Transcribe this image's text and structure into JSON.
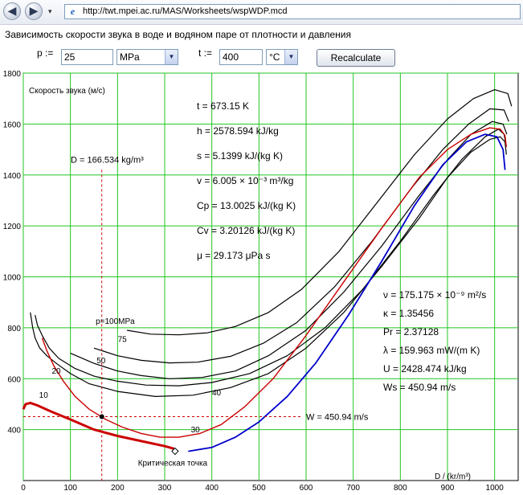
{
  "browser": {
    "url": "http://twt.mpei.ac.ru/MAS/Worksheets/wspWDP.mcd"
  },
  "page": {
    "title": "Зависимость скорости звука в воде и водяном паре  от плотности и давления",
    "pressure_label": "p :=",
    "pressure_value": "25",
    "pressure_unit": "MPa",
    "temperature_label": "t :=",
    "temperature_value": "400",
    "temperature_unit": "°C",
    "recalculate_label": "Recalculate"
  },
  "chart_data": {
    "type": "line",
    "title": "Скорость звука (м/с)",
    "xlabel": "D / (kr/m³)",
    "xlim": [
      0,
      1050
    ],
    "ylim": [
      200,
      1800
    ],
    "grid": true,
    "x_ticks": [
      0,
      100,
      200,
      300,
      400,
      500,
      600,
      700,
      800,
      900,
      1000
    ],
    "y_ticks": [
      400,
      600,
      800,
      1000,
      1200,
      1400,
      1600,
      1800
    ],
    "isobar_labels": [
      {
        "text": "p=100MPa",
        "x": 195,
        "y": 815
      },
      {
        "text": "75",
        "x": 210,
        "y": 745
      },
      {
        "text": "50",
        "x": 165,
        "y": 660
      },
      {
        "text": "40",
        "x": 410,
        "y": 535
      },
      {
        "text": "30",
        "x": 365,
        "y": 390
      },
      {
        "text": "20",
        "x": 70,
        "y": 620
      },
      {
        "text": "10",
        "x": 43,
        "y": 525
      }
    ],
    "series": [
      {
        "name": "",
        "color": "#000000",
        "width": 1.2,
        "x": [
          15,
          20,
          25,
          35,
          50,
          70,
          100,
          140,
          200,
          280,
          360,
          440,
          520,
          600,
          680,
          760,
          840,
          900,
          950,
          990,
          1012,
          1022,
          1025
        ],
        "y": [
          860,
          800,
          760,
          720,
          690,
          660,
          620,
          580,
          550,
          530,
          535,
          565,
          620,
          720,
          860,
          1040,
          1230,
          1390,
          1490,
          1540,
          1550,
          1530,
          1480
        ]
      },
      {
        "name": "",
        "color": "#000000",
        "width": 1.2,
        "x": [
          25,
          30,
          40,
          55,
          75,
          110,
          150,
          200,
          260,
          330,
          400,
          480,
          560,
          640,
          720,
          800,
          870,
          930,
          980,
          1008,
          1020,
          1024
        ],
        "y": [
          850,
          810,
          770,
          720,
          680,
          640,
          610,
          590,
          575,
          572,
          585,
          620,
          690,
          800,
          950,
          1140,
          1320,
          1460,
          1550,
          1580,
          1560,
          1520
        ]
      },
      {
        "name": "",
        "color": "#000000",
        "width": 1.2,
        "x": [
          100,
          150,
          200,
          250,
          310,
          380,
          450,
          520,
          600,
          680,
          760,
          840,
          900,
          950,
          995,
          1018,
          1026
        ],
        "y": [
          700,
          660,
          630,
          612,
          600,
          605,
          630,
          690,
          790,
          940,
          1120,
          1320,
          1460,
          1560,
          1610,
          1600,
          1560
        ]
      },
      {
        "name": "",
        "color": "#000000",
        "width": 1.2,
        "x": [
          150,
          200,
          250,
          310,
          370,
          440,
          510,
          580,
          660,
          740,
          820,
          890,
          945,
          990,
          1020,
          1030
        ],
        "y": [
          720,
          690,
          672,
          662,
          665,
          688,
          740,
          820,
          960,
          1140,
          1340,
          1500,
          1600,
          1660,
          1655,
          1610
        ]
      },
      {
        "name": "",
        "color": "#000000",
        "width": 1.2,
        "x": [
          220,
          270,
          330,
          390,
          450,
          520,
          590,
          670,
          750,
          830,
          900,
          955,
          1000,
          1028,
          1036
        ],
        "y": [
          790,
          775,
          772,
          780,
          805,
          860,
          950,
          1100,
          1290,
          1480,
          1620,
          1700,
          1735,
          1720,
          1670
        ]
      },
      {
        "name": "",
        "color": "#cc0000",
        "width": 1.4,
        "x": [
          40,
          50,
          65,
          85,
          110,
          140,
          175,
          210,
          250,
          290,
          330,
          375,
          420,
          470,
          530,
          600,
          680,
          760,
          840,
          900,
          950,
          990,
          1012,
          1022,
          1025
        ],
        "y": [
          760,
          710,
          650,
          590,
          530,
          480,
          440,
          410,
          385,
          370,
          370,
          385,
          420,
          490,
          600,
          770,
          980,
          1190,
          1390,
          1500,
          1560,
          1585,
          1580,
          1555,
          1510
        ]
      },
      {
        "name": "",
        "color": "#0000cc",
        "width": 1.8,
        "x": [
          350,
          400,
          450,
          500,
          560,
          620,
          690,
          760,
          830,
          890,
          940,
          980,
          1005,
          1018,
          1022
        ],
        "y": [
          315,
          330,
          370,
          430,
          530,
          660,
          850,
          1060,
          1280,
          1440,
          1530,
          1560,
          1550,
          1500,
          1420
        ]
      },
      {
        "name": "",
        "color": "#cc0000",
        "width": 3,
        "x": [
          0,
          5,
          15,
          30,
          60,
          100,
          150,
          200,
          250,
          300,
          320
        ],
        "y": [
          480,
          500,
          505,
          495,
          470,
          440,
          400,
          375,
          355,
          335,
          325
        ]
      }
    ],
    "annotations": {
      "state_point": {
        "x": 166.534,
        "y": 450.94
      },
      "critical_point": {
        "x": 322,
        "y": 315,
        "label": "Критическая точка"
      },
      "density_label": "D = 166.534 kg/m³",
      "speed_label": "W = 450.94 m/s",
      "properties_top": [
        "t = 673.15 K",
        "h = 2578.594 kJ/kg",
        "s = 5.1399 kJ/(kg K)",
        "v = 6.005 × 10⁻³ m³/kg",
        "Cp = 13.0025 kJ/(kg K)",
        "Cv = 3.20126 kJ/(kg K)",
        "μ = 29.173 μPa s"
      ],
      "properties_bottom": [
        "ν = 175.175 × 10⁻⁹ m²/s",
        "κ = 1.35456",
        "Pr = 2.37128",
        "λ = 159.963 mW/(m K)",
        "U = 2428.474 kJ/kg",
        "Ws = 450.94 m/s"
      ]
    }
  }
}
